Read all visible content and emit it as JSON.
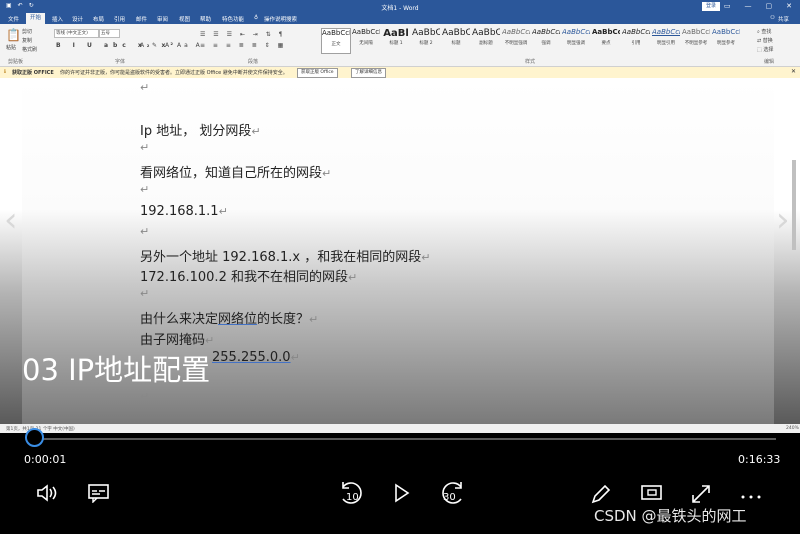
{
  "titlebar": {
    "title": "文档1 - Word",
    "login_label": "登录",
    "share_label": "共享"
  },
  "ribbon": {
    "tabs": [
      "文件",
      "开始",
      "插入",
      "设计",
      "布局",
      "引用",
      "邮件",
      "审阅",
      "视图",
      "帮助",
      "特色功能"
    ],
    "active_tab": "开始",
    "tell_me": "操作说明搜索",
    "paste_label": "粘贴",
    "clipboard_items": [
      "剪切",
      "复制",
      "格式刷"
    ],
    "font_name": "等线 (中文正文)",
    "font_size": "五号",
    "groups": [
      "剪贴板",
      "字体",
      "段落",
      "样式",
      "编辑"
    ],
    "styles": [
      {
        "sample": "AaBbCcDd",
        "name": "正文"
      },
      {
        "sample": "AaBbCcDd",
        "name": "无间隔"
      },
      {
        "sample": "AaBl",
        "name": "标题 1"
      },
      {
        "sample": "AaBbC",
        "name": "标题 2"
      },
      {
        "sample": "AaBbC",
        "name": "标题"
      },
      {
        "sample": "AaBbC",
        "name": "副标题"
      },
      {
        "sample": "AaBbCcDd",
        "name": "不明显强调"
      },
      {
        "sample": "AaBbCcDd",
        "name": "强调"
      },
      {
        "sample": "AaBbCcDd",
        "name": "明显强调"
      },
      {
        "sample": "AaBbCcDd",
        "name": "要点"
      },
      {
        "sample": "AaBbCcDd",
        "name": "引用"
      },
      {
        "sample": "AaBbCcDd",
        "name": "明显引用"
      },
      {
        "sample": "AaBbCcDd",
        "name": "不明显参考"
      },
      {
        "sample": "AaBbCcDd",
        "name": "明显参考"
      }
    ],
    "edit_items": [
      "查找",
      "替换",
      "选择"
    ]
  },
  "infobar": {
    "title": "获取正版 OFFICE",
    "message": "你的许可证并非正版，你可能是盗版软件的受害者。立即通过正版 Office 避免中断并使文件保持安全。",
    "btn_get": "获取正版 Office",
    "btn_more": "了解详细信息"
  },
  "document": {
    "para_mark": "↵",
    "lines": [
      {
        "text": "Ip 地址，    划分网段"
      },
      {
        "text": "看网络位，知道自己所在的网段"
      },
      {
        "text": "192.168.1.1"
      },
      {
        "text": "另外一个地址   192.168.1.x ，和我在相同的网段"
      },
      {
        "text": "  172.16.100.2    和我不在相同的网段"
      },
      {
        "pre": "由什么来决定",
        "ul": "网络位",
        "post": "的长度？"
      },
      {
        "text": "由子网掩码"
      },
      {
        "text": "255.255.0.0"
      }
    ]
  },
  "statusbar": {
    "left": "第1页，共1页   21 个字   中文(中国)",
    "zoom": "240%"
  },
  "player": {
    "video_title": "03 IP地址配置",
    "current_time": "0:00:01",
    "total_time": "0:16:33",
    "progress": 0.001,
    "rewind_seconds": "10",
    "forward_seconds": "30"
  },
  "watermark": "CSDN @最铁头的网工",
  "icons": [
    "save-icon",
    "undo-icon",
    "redo-icon",
    "search-icon",
    "person-icon",
    "volume-icon",
    "captions-icon",
    "rewind-10-icon",
    "play-icon",
    "forward-30-icon",
    "pen-icon",
    "miniplayer-icon",
    "fullscreen-icon",
    "more-icon",
    "chevron-left-icon",
    "chevron-right-icon"
  ],
  "colors": {
    "word_blue": "#2b579a",
    "progress_accent": "#3a8ee6",
    "info_bar": "#fff4ce"
  }
}
